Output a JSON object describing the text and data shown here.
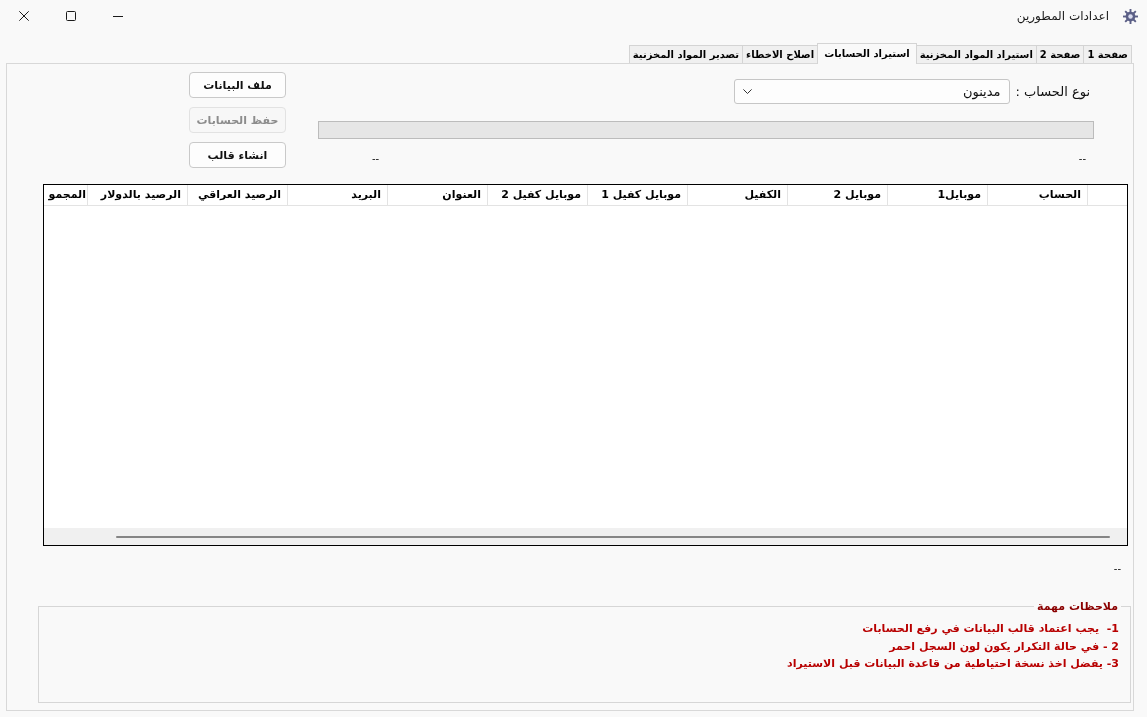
{
  "window": {
    "title": "اعدادات المطورين"
  },
  "tabs": [
    {
      "label": "صفحة 1",
      "selected": false
    },
    {
      "label": "صفحة 2",
      "selected": false
    },
    {
      "label": "استيراد المواد المخزنية",
      "selected": false
    },
    {
      "label": "استيراد الحسابات",
      "selected": true
    },
    {
      "label": "اصلاح الاخطاء",
      "selected": false
    },
    {
      "label": "تصدير المواد المخزنية",
      "selected": false
    }
  ],
  "account_type": {
    "label": "نوع الحساب :",
    "value": "مدينون"
  },
  "progress": {
    "level": 0
  },
  "status_labels": [
    "--",
    "--"
  ],
  "buttons": [
    {
      "label": "ملف البيانات",
      "disabled": false
    },
    {
      "label": "حفظ الحسابات",
      "disabled": true
    },
    {
      "label": "انشاء قالب",
      "disabled": false
    }
  ],
  "table": {
    "columns": [
      "الحساب",
      "موبايل1",
      "موبايل 2",
      "الكفيل",
      "موبايل كفيل 1",
      "موبايل كفيل 2",
      "العنوان",
      "البريد",
      "الرصيد العراقي",
      "الرصيد بالدولار",
      "المجمو"
    ]
  },
  "footer_label": "--",
  "notes": {
    "title": "ملاحظات مهمة",
    "lines": [
      "1-  يجب اعتماد قالب البيانات في رفع الحسابات",
      "2 - في حالة التكرار يكون لون السجل احمر",
      "3- يفضل اخذ نسخة احتياطية من قاعدة البيانات قبل الاستيراد"
    ]
  }
}
